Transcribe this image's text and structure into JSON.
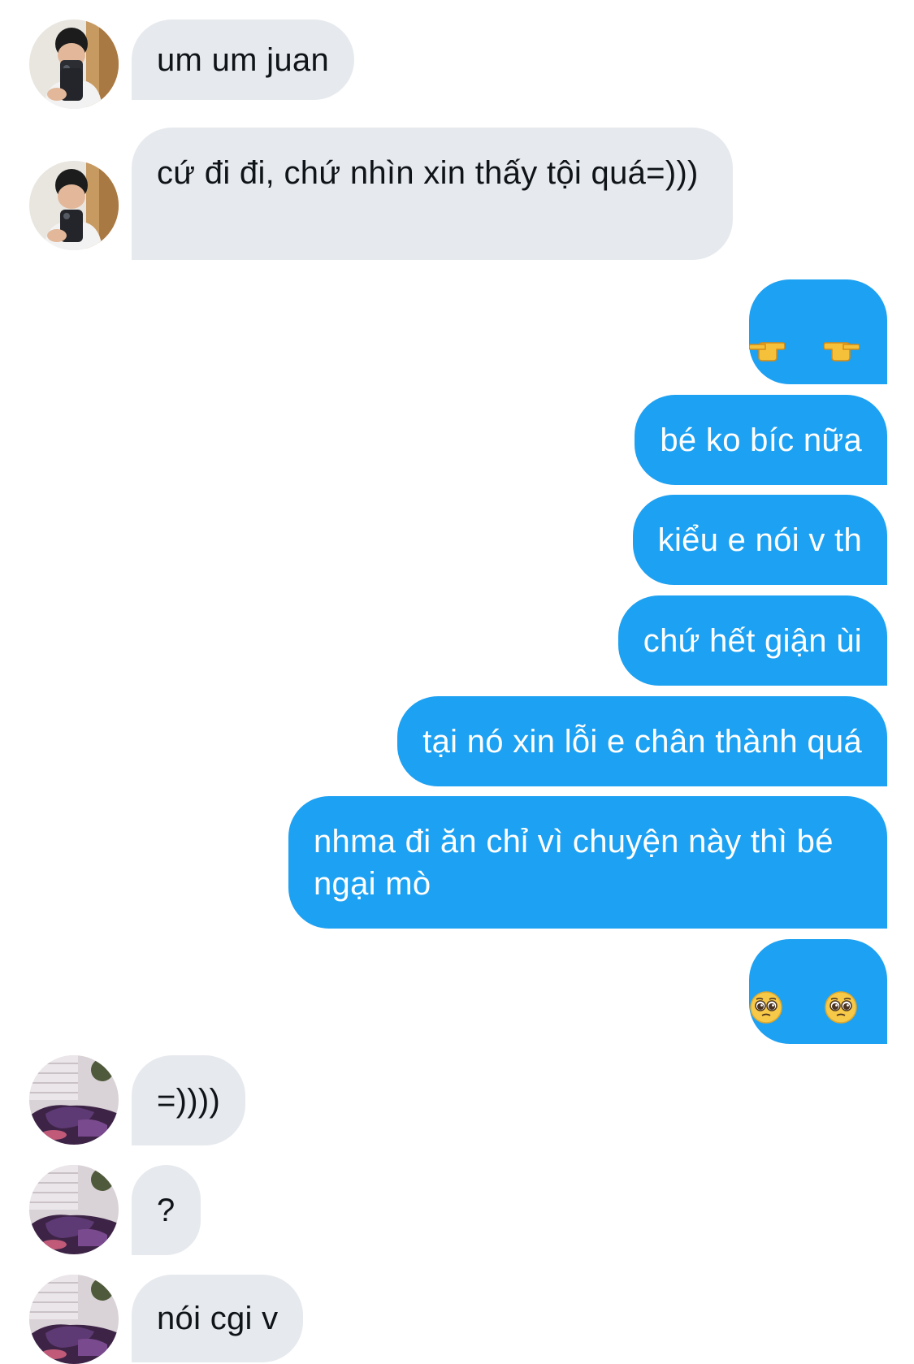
{
  "conversation": {
    "messages": [
      {
        "sender": "them",
        "avatar": "avatar-boy-phone-icon",
        "text": "um um juan"
      },
      {
        "sender": "them",
        "avatar": "avatar-boy-phone-icon",
        "text": "cứ đi đi, chứ nhìn xin thấy tội quá=)))"
      },
      {
        "sender": "me",
        "emoji": [
          "backhand-index-pointing-left",
          "backhand-index-pointing-right"
        ]
      },
      {
        "sender": "me",
        "text": "bé ko bíc nữa"
      },
      {
        "sender": "me",
        "text": "kiểu e nói v th"
      },
      {
        "sender": "me",
        "text": "chứ hết giận ùi"
      },
      {
        "sender": "me",
        "text": "tại nó xin lỗi e chân thành quá"
      },
      {
        "sender": "me",
        "text": "nhma đi ăn chỉ vì chuyện này thì bé ngại mò"
      },
      {
        "sender": "me",
        "emoji": [
          "pleading-face",
          "pleading-face"
        ]
      },
      {
        "sender": "them",
        "avatar": "avatar-purple-room-icon",
        "text": "=))))"
      },
      {
        "sender": "them",
        "avatar": "avatar-purple-room-icon",
        "text": "?"
      },
      {
        "sender": "them",
        "avatar": "avatar-purple-room-icon",
        "text": "nói cgi v"
      }
    ]
  },
  "colors": {
    "incoming_bubble": "#e6e9ed",
    "incoming_text": "#0f1419",
    "outgoing_bubble": "#1da1f2",
    "outgoing_text": "#ffffff"
  }
}
